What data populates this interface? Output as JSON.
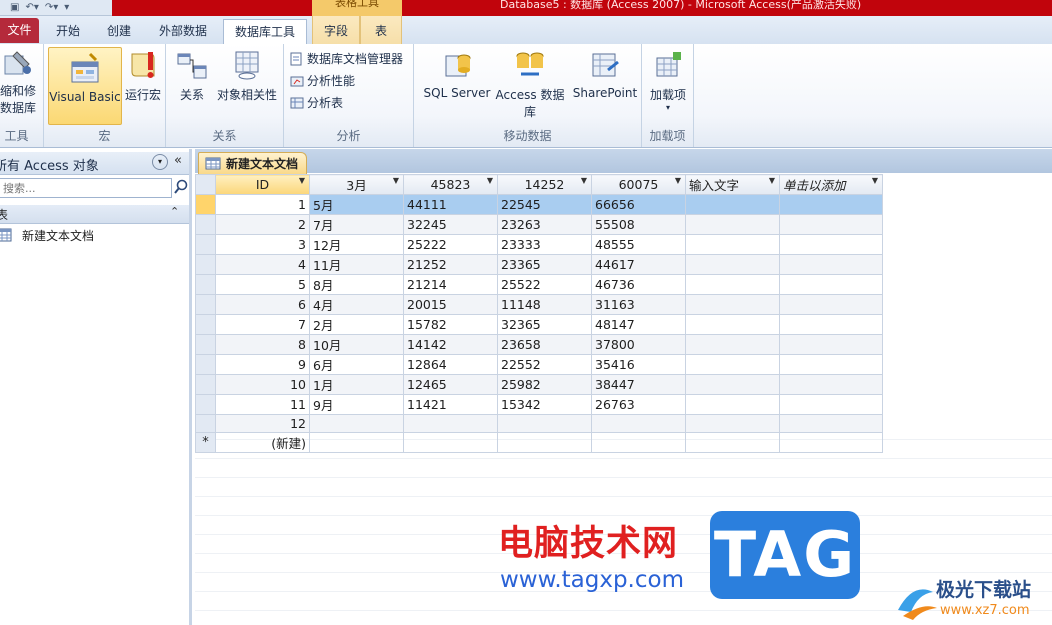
{
  "window": {
    "title": "Database5 : 数据库 (Access 2007) - Microsoft Access(产品激活失败)",
    "context_group_label": "表格工具"
  },
  "tabs": [
    {
      "label": "文件"
    },
    {
      "label": "开始"
    },
    {
      "label": "创建"
    },
    {
      "label": "外部数据"
    },
    {
      "label": "数据库工具"
    },
    {
      "label": "字段"
    },
    {
      "label": "表"
    }
  ],
  "ribbon": {
    "groups": {
      "tools": {
        "label": "工具",
        "compact_line1": "缩和修",
        "compact_line2": "数据库"
      },
      "macro": {
        "label": "宏",
        "visual_basic": "Visual Basic",
        "run_macro": "运行宏"
      },
      "relationships": {
        "label": "关系",
        "relations": "关系",
        "object_dependencies": "对象相关性"
      },
      "analyze": {
        "label": "分析",
        "documenter": "数据库文档管理器",
        "analyze_performance": "分析性能",
        "analyze_table": "分析表"
      },
      "move_data": {
        "label": "移动数据",
        "sql_server": "SQL Server",
        "access_db": "Access 数据库",
        "sharepoint": "SharePoint"
      },
      "addins": {
        "label": "加载项",
        "addins_btn": "加载项"
      }
    }
  },
  "nav_pane": {
    "title": "所有 Access 对象",
    "search_placeholder": "搜索...",
    "group_label": "表",
    "items": [
      {
        "label": "新建文本文档"
      }
    ]
  },
  "document": {
    "tab_label": "新建文本文档",
    "columns": [
      "ID",
      "3月",
      "45823",
      "14252",
      "60075",
      "输入文字",
      "单击以添加"
    ],
    "rows": [
      [
        "1",
        "5月",
        "44111",
        "22545",
        "66656"
      ],
      [
        "2",
        "7月",
        "32245",
        "23263",
        "55508"
      ],
      [
        "3",
        "12月",
        "25222",
        "23333",
        "48555"
      ],
      [
        "4",
        "11月",
        "21252",
        "23365",
        "44617"
      ],
      [
        "5",
        "8月",
        "21214",
        "25522",
        "46736"
      ],
      [
        "6",
        "4月",
        "20015",
        "11148",
        "31163"
      ],
      [
        "7",
        "2月",
        "15782",
        "32365",
        "48147"
      ],
      [
        "8",
        "10月",
        "14142",
        "23658",
        "37800"
      ],
      [
        "9",
        "6月",
        "12864",
        "22552",
        "35416"
      ],
      [
        "10",
        "1月",
        "12465",
        "25982",
        "38447"
      ],
      [
        "11",
        "9月",
        "11421",
        "15342",
        "26763"
      ],
      [
        "12",
        "",
        "",
        "",
        ""
      ]
    ],
    "new_row_marker": "*",
    "new_row_label": "(新建)"
  },
  "watermark": {
    "cn_text": "电脑技术网",
    "url": "www.tagxp.com",
    "tag": "TAG",
    "logo_text": "极光下载站",
    "logo_url": "www.xz7.com"
  },
  "colors": {
    "title_bar": "#c1040c",
    "file_tab": "#b52a3b",
    "selected_row": "#a9cdf0",
    "current_selector": "#ffd46b",
    "tag_badge": "#2b7fdd",
    "watermark_red": "#e02020",
    "watermark_blue": "#2a62d6"
  }
}
